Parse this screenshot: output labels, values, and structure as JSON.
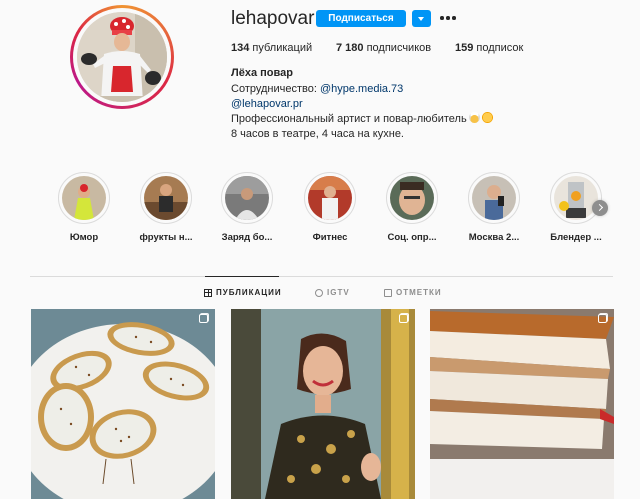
{
  "profile": {
    "username": "lehapovar",
    "follow_label": "Подписаться",
    "stats": {
      "posts_count": "134",
      "posts_label": " публикаций",
      "followers_count": "7 180",
      "followers_label": " подписчиков",
      "following_count": "159",
      "following_label": " подписок"
    },
    "bio": {
      "name": "Лёха повар",
      "collab_prefix": "Сотрудничество: ",
      "collab_link": "@hype.media.73",
      "link2": "@lehapovar.pr",
      "line1": "Профессиональный артист и повар-любитель",
      "line2": "8 часов в театре, 4 часа на кухне."
    }
  },
  "highlights": [
    {
      "label": "Юмор"
    },
    {
      "label": "фрукты н..."
    },
    {
      "label": "Заряд бо..."
    },
    {
      "label": "Фитнес"
    },
    {
      "label": "Соц. опр..."
    },
    {
      "label": "Москва 2..."
    },
    {
      "label": "Блендер ..."
    }
  ],
  "tabs": [
    {
      "label": "ПУБЛИКАЦИИ"
    },
    {
      "label": "IGTV"
    },
    {
      "label": "ОТМЕТКИ"
    }
  ],
  "icons": {
    "grid": "grid-icon",
    "igtv": "igtv-icon",
    "tag": "tagged-icon",
    "more": "more-horizontal-icon",
    "carousel": "carousel-icon"
  },
  "colors": {
    "accent": "#0095f6",
    "link": "#00376b",
    "muted": "#8e8e8e"
  }
}
